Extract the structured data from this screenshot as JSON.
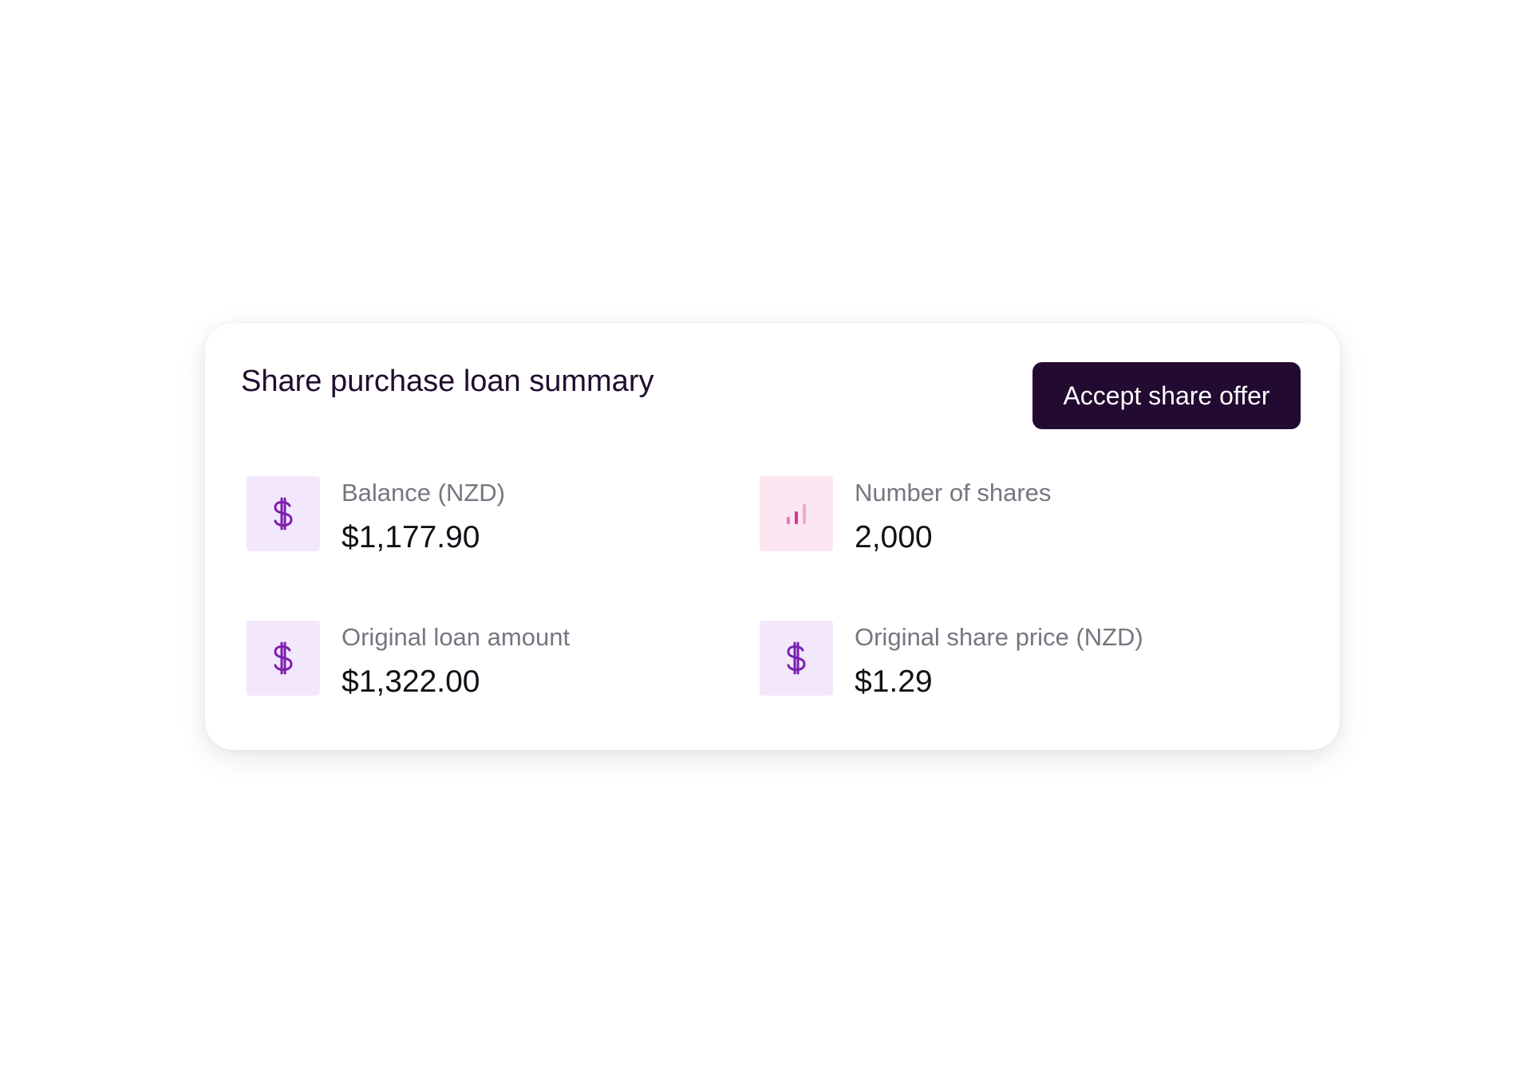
{
  "card": {
    "title": "Share purchase loan summary",
    "accept_button": "Accept share offer"
  },
  "stats": [
    {
      "label": "Balance (NZD)",
      "value": "$1,177.90",
      "icon": "dollar-icon"
    },
    {
      "label": "Number of shares",
      "value": "2,000",
      "icon": "bar-chart-icon"
    },
    {
      "label": "Original loan amount",
      "value": "$1,322.00",
      "icon": "dollar-icon"
    },
    {
      "label": "Original share price (NZD)",
      "value": "$1.29",
      "icon": "dollar-icon"
    }
  ],
  "colors": {
    "button_bg": "#220a30",
    "icon_purple": "#7a1fb0",
    "icon_purple_bg": "#f3e7fb",
    "icon_pink": "#d6378f",
    "icon_pink_bg": "#fbe6f1"
  }
}
